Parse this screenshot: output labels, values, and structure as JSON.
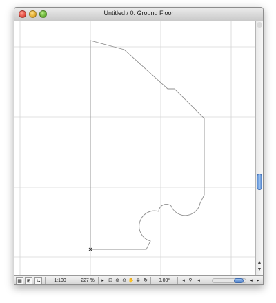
{
  "window": {
    "title": "Untitled / 0. Ground Floor"
  },
  "status_bar": {
    "scale": "1:100",
    "zoom": "227 %",
    "angle": "0.00°"
  },
  "icons": {
    "close": "close-icon",
    "minimize": "minimize-icon",
    "zoom": "zoom-icon",
    "origin": "origin-marker-icon"
  },
  "colors": {
    "grid": "#d6d6d6",
    "drawing": "#8f8f8f",
    "scroll_thumb": "#6f9fe0"
  }
}
